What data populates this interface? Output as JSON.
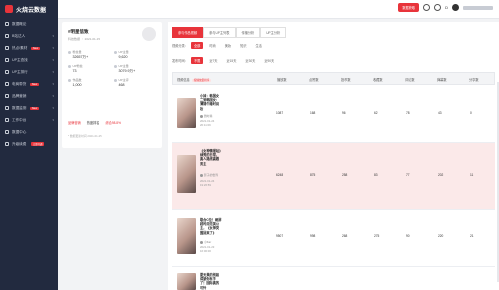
{
  "app": {
    "name": "火烧云数据"
  },
  "sidebar": {
    "items": [
      {
        "label": "数据概论",
        "icon": "dashboard-icon",
        "badge": ""
      },
      {
        "label": "B站达人",
        "icon": "user-icon",
        "badge": ""
      },
      {
        "label": "热点/素材",
        "icon": "fire-icon",
        "badge": "New"
      },
      {
        "label": "UP主查找",
        "icon": "search-icon",
        "badge": ""
      },
      {
        "label": "UP主排行",
        "icon": "rank-icon",
        "badge": ""
      },
      {
        "label": "电商带货",
        "icon": "cart-icon",
        "badge": "New"
      },
      {
        "label": "品牌营销",
        "icon": "brand-icon",
        "badge": ""
      },
      {
        "label": "数据监测",
        "icon": "monitor-icon",
        "badge": "New"
      },
      {
        "label": "工作中台",
        "icon": "desk-icon",
        "badge": ""
      },
      {
        "label": "数据中心",
        "icon": "data-icon",
        "badge": ""
      },
      {
        "label": "升级续费",
        "icon": "upgrade-icon",
        "badge": "立即开通"
      }
    ]
  },
  "topbar": {
    "cta": "数据获取",
    "user": "D"
  },
  "profile": {
    "name": "#明星信致",
    "subtitle": "科技数据 ∶ 2021-01-15",
    "stats": [
      {
        "label": "粉丝量",
        "value": "32657万+"
      },
      {
        "label": "UP主量",
        "value": "9,620"
      },
      {
        "label": "UP粉丝",
        "value": "73"
      },
      {
        "label": "UP主量",
        "value": "3079.9万+"
      },
      {
        "label": "作品数",
        "value": "1,000"
      },
      {
        "label": "UP主评",
        "value": "468"
      }
    ],
    "tabs": [
      "品牌营销",
      "热度排名",
      "综合98.8%"
    ],
    "update_note": "* 数据更新时间 2021-01-25"
  },
  "main": {
    "tabs": [
      "参与作品视频",
      "参与UP主列表",
      "传播分析",
      "UP主分析"
    ],
    "filter1": {
      "label": "视频分类：",
      "options": [
        "全部",
        "时尚",
        "美妆",
        "知识",
        "生活"
      ]
    },
    "filter2": {
      "label": "发布时间：",
      "options": [
        "不限",
        "近7天",
        "近15天",
        "近30天",
        "近90天"
      ]
    },
    "columns": [
      "视频信息",
      "播放数",
      "点赞数",
      "投币数",
      "收藏数",
      "评论数",
      "弹幕数",
      "分享数"
    ],
    "col_tag": "按播放量排序"
  },
  "rows": [
    {
      "title": "小妹：韩国女二到韩国女：薄锦午睡时尚妆",
      "author": "微时尚",
      "date": "2021-01-24 20:11:09",
      "values": [
        "1087",
        "168",
        "96",
        "62",
        "78",
        "43",
        "0"
      ]
    },
    {
      "title": "《女神情报站》绿秀的日常，真人路线高跟男主",
      "author": "影子的世界",
      "date": "2021-01-24 19:26:59",
      "values": [
        "6248",
        "875",
        "258",
        "83",
        "77",
        "202",
        "11"
      ]
    },
    {
      "title": "联合C位！刷屏超时尚完美公主，《女神突围回来了》",
      "author": "小Kar",
      "date": "2021-01-23 16:00:00",
      "values": [
        "9507",
        "998",
        "268",
        "275",
        "90",
        "220",
        "21"
      ]
    },
    {
      "title": "夏天果的别装得瑟你有手了！国际真的可怜",
      "author": "",
      "date": "",
      "values": [
        "",
        "",
        "",
        "",
        "",
        "",
        ""
      ]
    }
  ],
  "colors": {
    "accent": "#e8343b",
    "sidebar_bg": "#222a3f",
    "highlight_row": "#fbe9e9"
  }
}
